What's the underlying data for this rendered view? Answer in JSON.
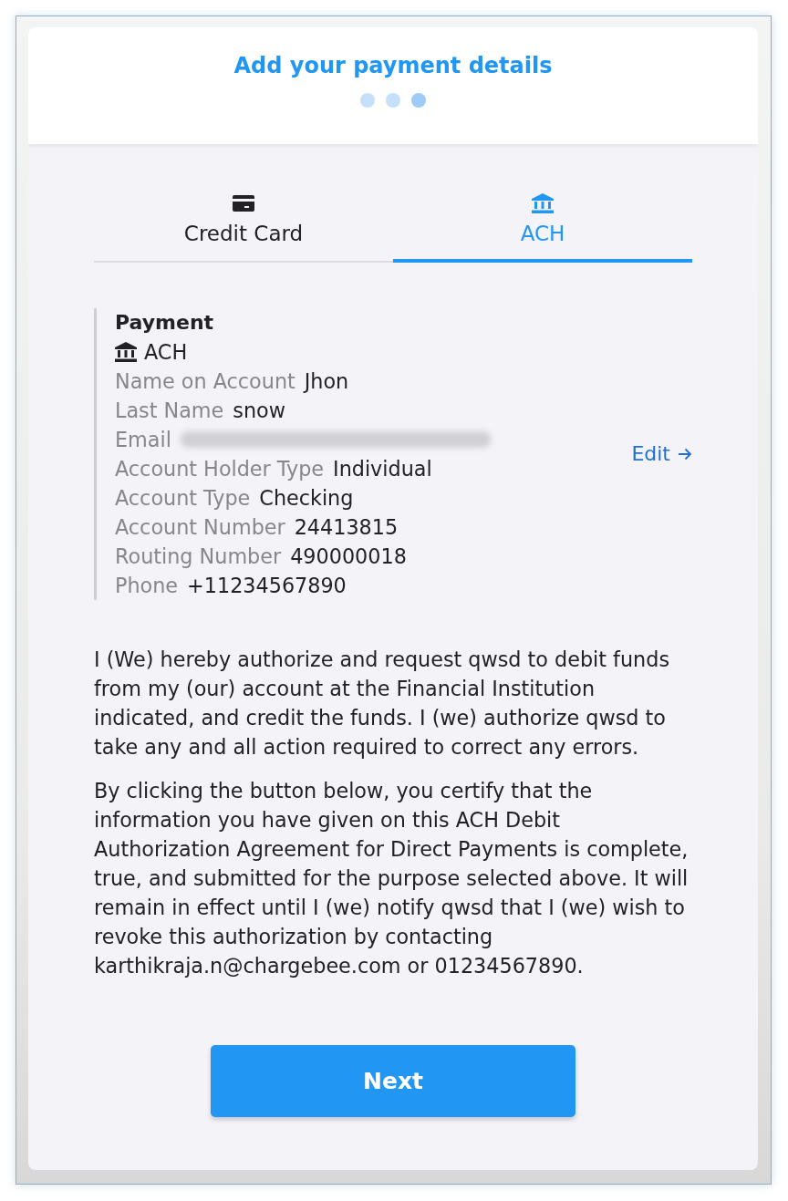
{
  "header": {
    "title": "Add your payment details",
    "steps": [
      {
        "selected": false
      },
      {
        "selected": false
      },
      {
        "selected": true
      }
    ]
  },
  "tabs": [
    {
      "kind": "card",
      "label": "Credit Card",
      "selected": false
    },
    {
      "kind": "bank",
      "label": "ACH",
      "selected": true
    }
  ],
  "payment": {
    "heading": "Payment",
    "method": "ACH",
    "rows": [
      {
        "kind": "text",
        "label": "Name on Account",
        "value": "Jhon"
      },
      {
        "kind": "text",
        "label": "Last Name",
        "value": "snow"
      },
      {
        "kind": "redacted",
        "label": "Email"
      },
      {
        "kind": "text",
        "label": "Account Holder Type",
        "value": "Individual"
      },
      {
        "kind": "text",
        "label": "Account Type",
        "value": "Checking"
      },
      {
        "kind": "text",
        "label": "Account Number",
        "value": "24413815"
      },
      {
        "kind": "text",
        "label": "Routing Number",
        "value": "490000018"
      },
      {
        "kind": "text",
        "label": "Phone",
        "value": "+11234567890"
      }
    ],
    "edit_link": "Edit"
  },
  "paragraphs": [
    "I (We) hereby authorize and request qwsd to debit funds from my (our) account at the Financial Institution indicated, and credit the funds. I (we) authorize qwsd to take any and all action required to correct any errors.",
    "By clicking the button below, you certify that the information you have given on this ACH Debit Authorization Agreement for Direct Payments is complete, true, and submitted for the purpose selected above. It will remain in effect until I (we) notify qwsd that I (we) wish to revoke this authorization by contacting karthikraja.n@chargebee.com or 01234567890."
  ],
  "next_button": "Next"
}
